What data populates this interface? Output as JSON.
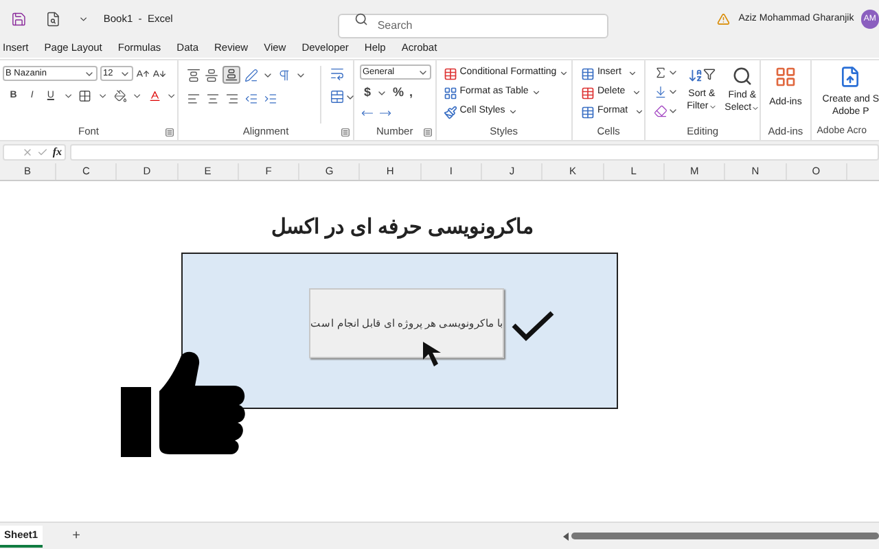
{
  "title_bar": {
    "title": "Book1  -  Excel",
    "search": {
      "placeholder": "Search"
    },
    "user_name": "Aziz Mohammad Gharanjik",
    "avatar": "AM"
  },
  "tabs": [
    {
      "label": "Insert",
      "selected": false
    },
    {
      "label": "Page Layout",
      "selected": false
    },
    {
      "label": "Formulas",
      "selected": false
    },
    {
      "label": "Data",
      "selected": false
    },
    {
      "label": "Review",
      "selected": false
    },
    {
      "label": "View",
      "selected": false
    },
    {
      "label": "Developer",
      "selected": false
    },
    {
      "label": "Help",
      "selected": false
    },
    {
      "label": "Acrobat",
      "selected": false
    }
  ],
  "ribbon": {
    "font": {
      "label": "Font",
      "font_name": "B Nazanin",
      "font_size": "12",
      "style_buttons": [
        "B",
        "I",
        "U"
      ]
    },
    "alignment": {
      "label": "Alignment"
    },
    "number": {
      "label": "Number",
      "format": "General",
      "symbols": [
        "$",
        "%",
        ","
      ]
    },
    "styles": {
      "label": "Styles",
      "buttons": [
        "Conditional Formatting",
        "Format as Table",
        "Cell Styles"
      ]
    },
    "cells": {
      "label": "Cells",
      "buttons": [
        "Insert",
        "Delete",
        "Format"
      ]
    },
    "editing": {
      "label": "Editing",
      "buttons": [
        {
          "line1": "Sort &",
          "line2": "Filter"
        },
        {
          "line1": "Find &",
          "line2": "Select"
        }
      ]
    },
    "addins": {
      "label": "Add-ins",
      "button": "Add-ins"
    },
    "acrobat": {
      "label": "Adobe Acro",
      "line1": "Create and S",
      "line2": "Adobe P"
    }
  },
  "formula_bar": {
    "fx": "fx"
  },
  "columns": [
    "B",
    "C",
    "D",
    "E",
    "F",
    "G",
    "H",
    "I",
    "J",
    "K",
    "L",
    "M",
    "N",
    "O"
  ],
  "sheet": {
    "heading": "ماکرونویسی حرفه ای در اکسل",
    "button_text": "با ماکرونویسی هر پروژه ای قابل انجام است"
  },
  "sheet_tabs": [
    {
      "label": "Sheet1",
      "selected": true
    }
  ],
  "add_sheet": "+"
}
